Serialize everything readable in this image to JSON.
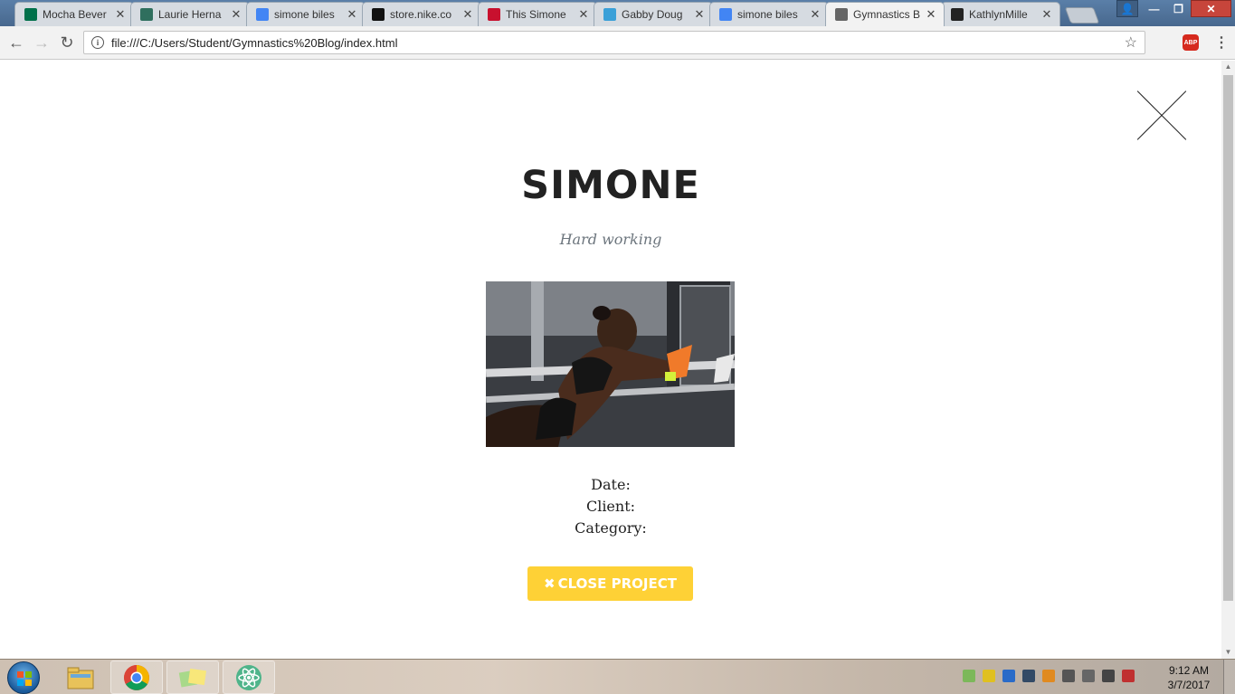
{
  "browser": {
    "tabs": [
      {
        "title": "Mocha Bever",
        "favicon": "starbucks-icon",
        "color": "#00704a"
      },
      {
        "title": "Laurie Herna",
        "favicon": "h-icon",
        "color": "#2f6f5e"
      },
      {
        "title": "simone biles",
        "favicon": "google-icon",
        "color": "#4285f4"
      },
      {
        "title": "store.nike.co",
        "favicon": "nike-icon",
        "color": "#111111"
      },
      {
        "title": "This Simone",
        "favicon": "t-icon",
        "color": "#c8102e"
      },
      {
        "title": "Gabby Doug",
        "favicon": "j-icon",
        "color": "#3aa0d8"
      },
      {
        "title": "simone biles",
        "favicon": "google-icon",
        "color": "#4285f4"
      },
      {
        "title": "Gymnastics B",
        "favicon": "page-icon",
        "color": "#666666"
      },
      {
        "title": "KathlynMille",
        "favicon": "github-icon",
        "color": "#222222"
      }
    ],
    "active_tab_index": 7,
    "url": "file:///C:/Users/Student/Gymnastics%20Blog/index.html",
    "extension_label": "ABP"
  },
  "page": {
    "title": "SIMONE",
    "subtitle": "Hard working",
    "meta": {
      "date_label": "Date:",
      "client_label": "Client:",
      "category_label": "Category:"
    },
    "close_button_label": "CLOSE PROJECT",
    "close_button_icon": "times-icon",
    "accent_color": "#fed136"
  },
  "taskbar": {
    "time": "9:12 AM",
    "date": "3/7/2017",
    "pinned": [
      "explorer-icon",
      "chrome-icon",
      "sticky-notes-icon",
      "atom-icon"
    ]
  }
}
